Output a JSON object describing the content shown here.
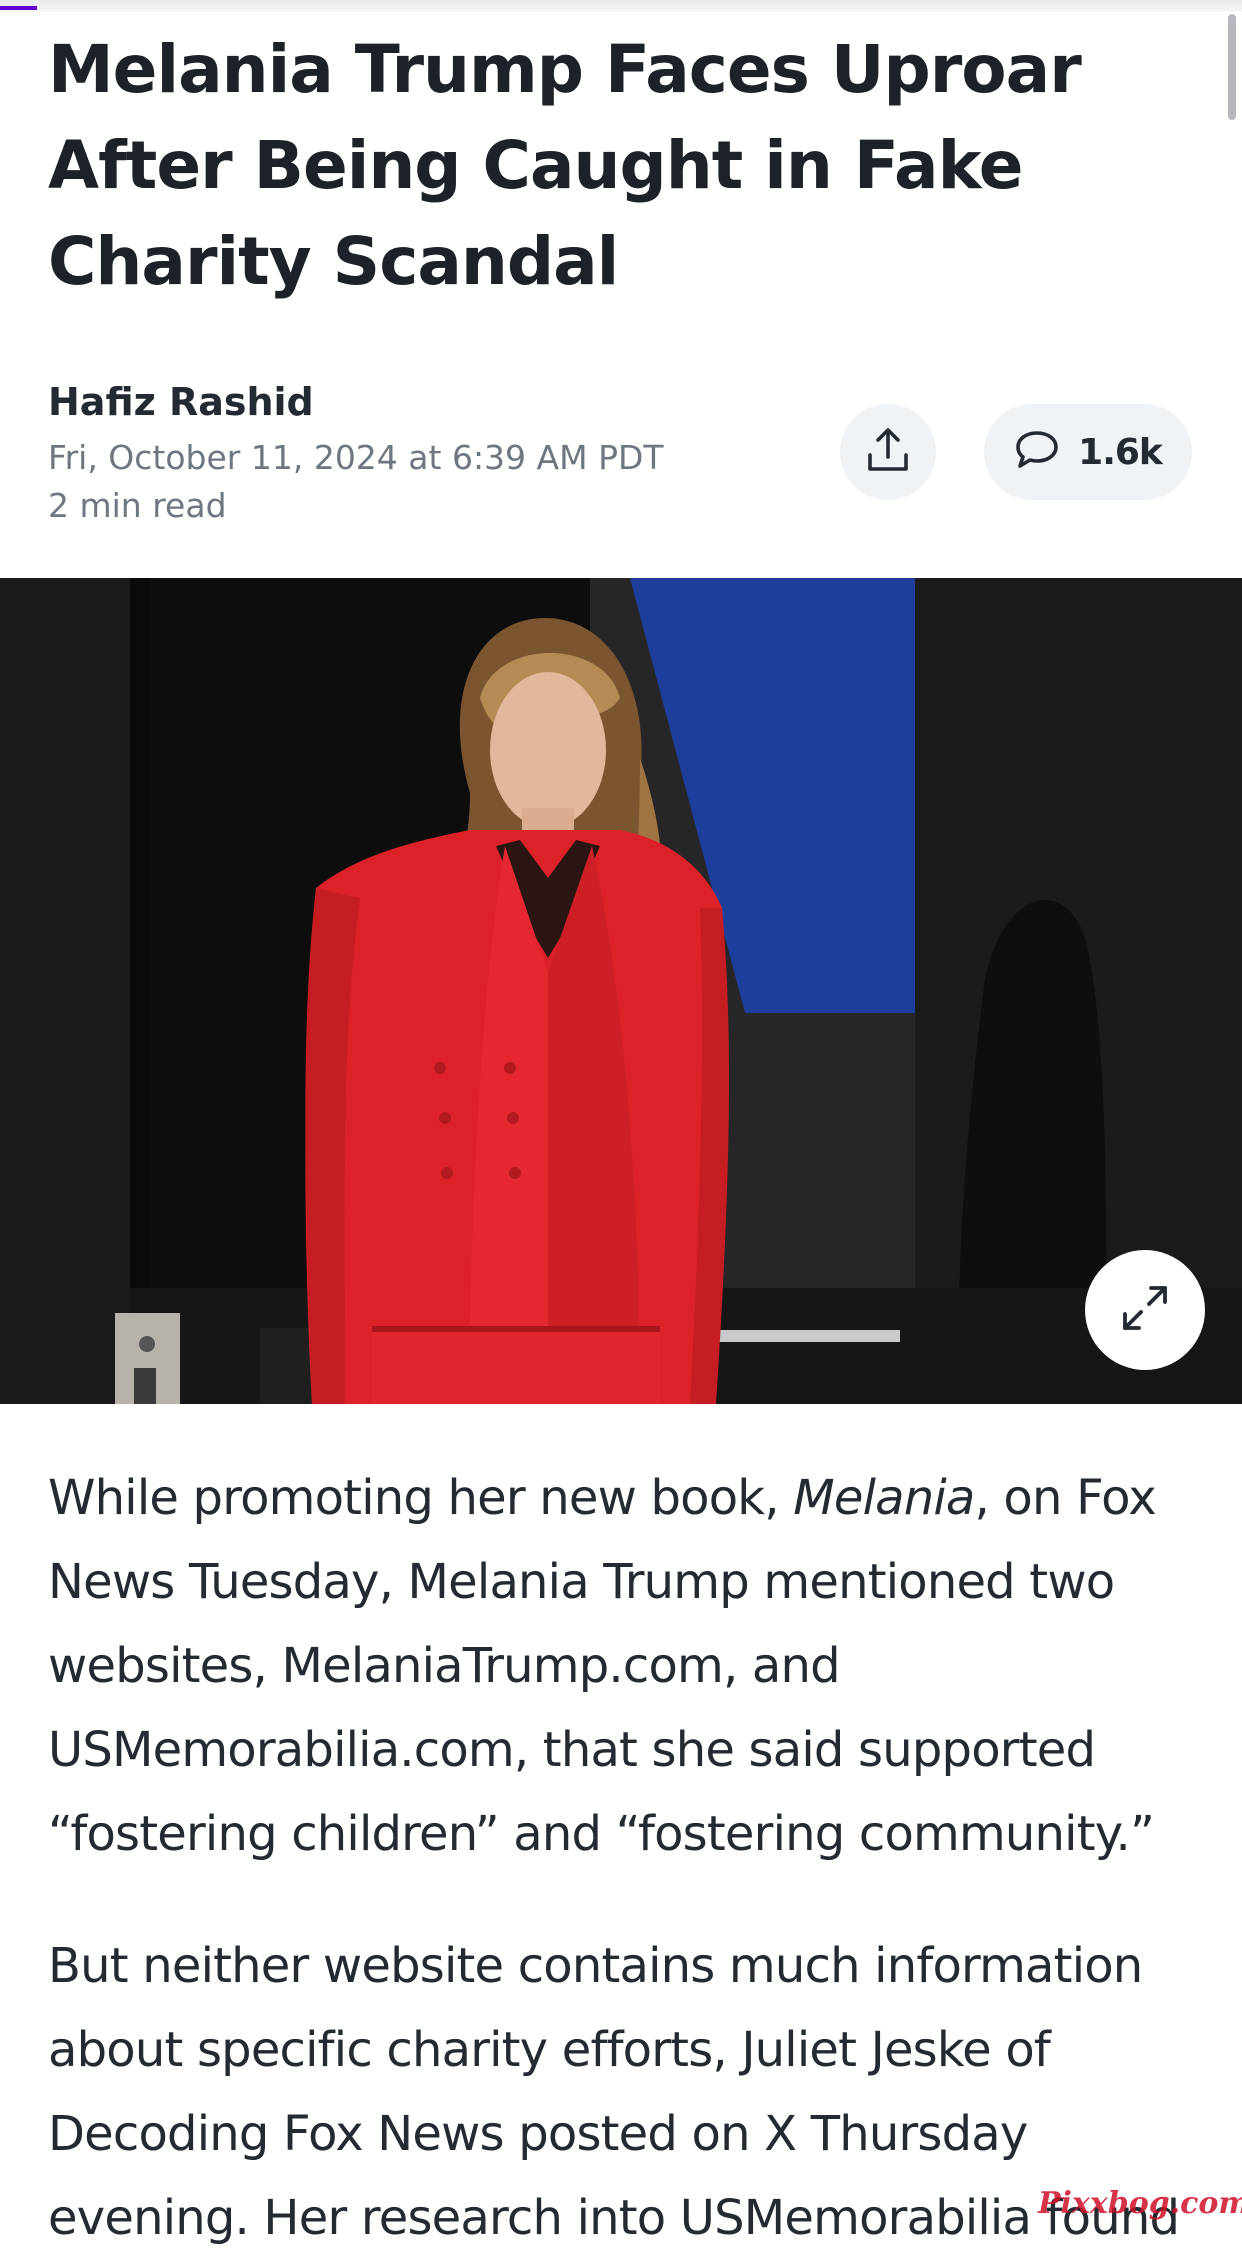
{
  "article": {
    "headline": "Melania Trump Faces Uproar After Being Caught in Fake Charity Scandal",
    "author": "Hafiz Rashid",
    "published": "Fri, October 11, 2024 at 6:39 AM PDT",
    "read_time": "2 min read",
    "reading_progress": 0.03
  },
  "actions": {
    "share_icon": "share-upload-icon",
    "comment_icon": "speech-bubble-icon",
    "comment_count": "1.6k"
  },
  "hero_image": {
    "subject": "photo-woman-in-red-suit-on-stage",
    "expand_icon": "expand-arrows-icon"
  },
  "body": {
    "p1": {
      "before": "While promoting her new book, ",
      "italic": "Melania",
      "after": ", on Fox News Tuesday, Melania Trump mentioned two websites, MelaniaTrump.com, and USMemorabilia.com, that she said supported “fostering children” and “fostering community.”"
    },
    "p2": "But neither website contains much information about specific charity efforts, Juliet Jeske of Decoding Fox News posted on X Thursday evening. Her research into USMemorabilia found"
  },
  "watermark": "Pixxbog.com",
  "colors": {
    "accent": "#6001d2",
    "text": "#232a31",
    "muted": "#6e7780",
    "button_bg": "#f0f3f5",
    "suit_red": "#e0262c",
    "watermark": "#d0102a"
  }
}
